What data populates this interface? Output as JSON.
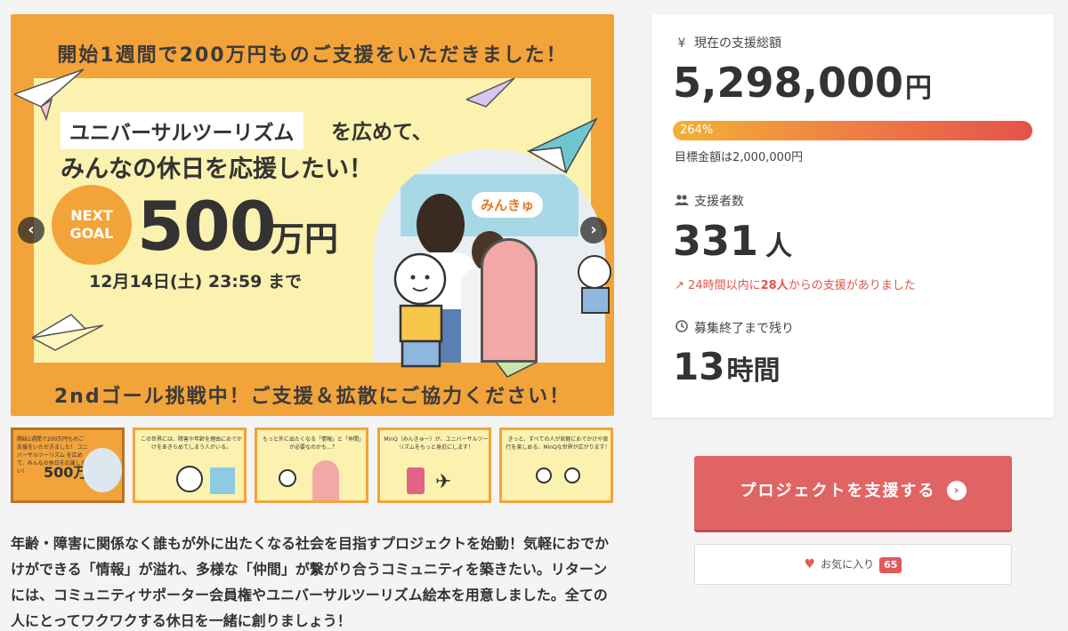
{
  "hero": {
    "top_text": "開始1週間で200万円ものご支援をいただきました！",
    "headline_tag": "ユニバーサルツーリズム",
    "headline_rest": "を広めて、",
    "headline_line2": "みんなの休日を応援したい！",
    "next_goal": "NEXT GOAL",
    "goal_amount": "500",
    "goal_unit": "万円",
    "deadline": "12月14日(土) 23:59 まで",
    "bottom_text": "2ndゴール挑戦中！ご支援＆拡散にご協力ください！",
    "photo_sign": "みんきゅ"
  },
  "thumbnails": [
    {
      "text": "開始1週間で200万円ものご支援をいただきました！ ユニバーサルツーリズム を広めて、みんなの休日を応援したい！",
      "amount": "500万円"
    },
    {
      "text": "この世界には、障害や年齢を理由におでかけをあきらめてしまう人がいる。"
    },
    {
      "text": "もっと外に出たくなる「情報」と「仲間」が必要なのかも…？"
    },
    {
      "text": "MinQ（みんきゅー）が、ユニバーサルツーリズムをもっと身近にします！"
    },
    {
      "text": "きっと、すべての人が気軽におでかけや旅行を楽しめる、MinQな世界が広がります！"
    }
  ],
  "description": "年齢・障害に関係なく誰もが外に出たくなる社会を目指すプロジェクトを始動！気軽におでかけができる「情報」が溢れ、多様な「仲間」が繋がり合うコミュニティを築きたい。リターンには、コミュニティサポーター会員権やユニバーサルツーリズム絵本を用意しました。全ての人にとってワクワクする休日を一緒に創りましょう！",
  "stats": {
    "total_label": "現在の支援総額",
    "total_value": "5,298,000",
    "total_unit": "円",
    "progress_label": "264%",
    "progress_percent": 264,
    "target": "目標金額は2,000,000円",
    "supporters_label": "支援者数",
    "supporters_value": "331",
    "supporters_unit": "人",
    "recent_prefix": "24時間以内に",
    "recent_count": "28人",
    "recent_suffix": "からの支援がありました",
    "remaining_label": "募集終了まで残り",
    "remaining_value": "13",
    "remaining_unit": "時間"
  },
  "actions": {
    "support_label": "プロジェクトを支援する",
    "favorite_label": "お気に入り",
    "favorite_count": "65"
  },
  "colors": {
    "accent": "#e06464",
    "banner": "#f2a33a",
    "banner_inner": "#fcf2b0",
    "recent": "#e4534a"
  }
}
